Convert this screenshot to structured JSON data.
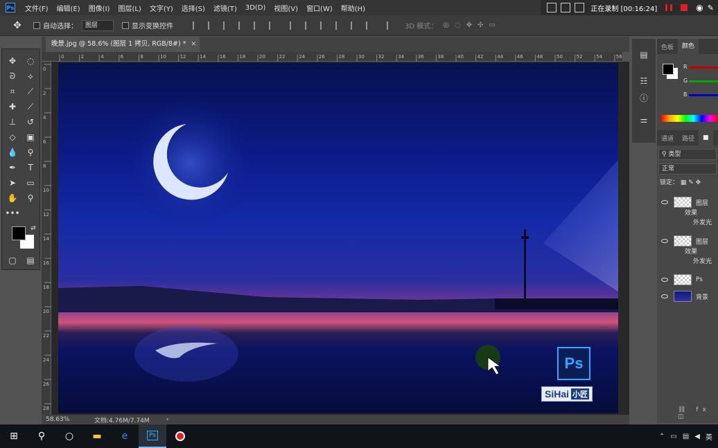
{
  "menubar": {
    "items": [
      "文件(F)",
      "编辑(E)",
      "图像(I)",
      "图层(L)",
      "文字(Y)",
      "选择(S)",
      "滤镜(T)",
      "3D(D)",
      "视图(V)",
      "窗口(W)",
      "帮助(H)"
    ]
  },
  "recorder": {
    "label": "正在录制",
    "time": "[00:16:24]"
  },
  "options": {
    "auto_select_label": "自动选择：",
    "auto_select_value": "图层",
    "show_transform_label": "显示变换控件",
    "mode_3d_label": "3D 模式："
  },
  "document": {
    "tab_title": "晚景.jpg @ 58.6% (图层 1 拷贝, RGB/8#) *",
    "close": "×"
  },
  "ruler": {
    "h_ticks": [
      "0",
      "2",
      "4",
      "6",
      "8",
      "10",
      "12",
      "14",
      "16",
      "18",
      "20",
      "22",
      "24",
      "26",
      "28",
      "30",
      "32",
      "34",
      "36",
      "38",
      "40",
      "42",
      "44",
      "46",
      "48",
      "50",
      "52",
      "54",
      "56"
    ],
    "v_ticks": [
      "0",
      "2",
      "4",
      "6",
      "8",
      "10",
      "12",
      "14",
      "16",
      "18",
      "20",
      "22",
      "24",
      "26",
      "28"
    ]
  },
  "status": {
    "zoom": "58.63%",
    "doc_size": "文档:4.76M/7.74M",
    "arrow": "›"
  },
  "panels": {
    "color_tab": "色板",
    "swatch_tab": "颜色",
    "channels_tab": "通道",
    "paths_tab": "路径",
    "filter_type": "类型",
    "blend_mode": "正常",
    "lock_label": "锁定：",
    "channel_labels": [
      "R",
      "G",
      "B"
    ]
  },
  "layers": [
    {
      "name": "图层",
      "effect": "效果",
      "sub": "外发光",
      "thumb": "transparent"
    },
    {
      "name": "图层",
      "effect": "效果",
      "sub": "外发光",
      "thumb": "transparent"
    },
    {
      "name": "Ps",
      "thumb": "transparent"
    },
    {
      "name": "背景",
      "thumb": "image"
    }
  ],
  "watermark": {
    "ps": "Ps",
    "brand": "SiHai",
    "brand_cn": "小匠"
  },
  "taskbar": {
    "lang": "英"
  },
  "colors": {
    "accent": "#31a8ff",
    "record": "#e02020"
  }
}
